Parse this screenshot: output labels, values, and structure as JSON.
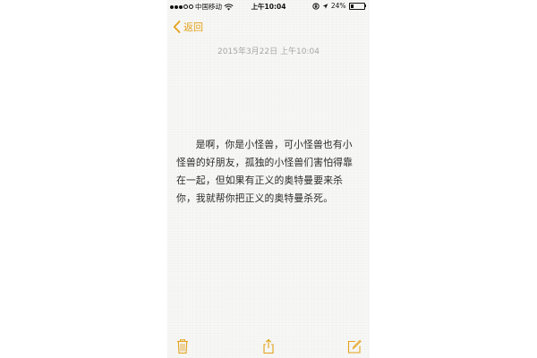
{
  "status_bar": {
    "carrier": "中国移动",
    "time": "上午10:04",
    "battery_percent_label": "24%",
    "battery_level": 0.24,
    "signal_bars_filled": 3,
    "signal_bars_total": 5
  },
  "nav": {
    "back_label": "返回"
  },
  "note": {
    "date": "2015年3月22日 上午10:04",
    "text": "是啊，你是小怪兽，可小怪兽也有小怪兽的好朋友，孤独的小怪兽们害怕得靠在一起，但如果有正义的奥特曼要来杀你，我就帮你把正义的奥特曼杀死。"
  },
  "toolbar": {
    "icons": [
      "trash-icon",
      "share-icon",
      "compose-icon"
    ]
  },
  "colors": {
    "accent": "#e3a21a",
    "background": "#f7f7f5",
    "date_text": "#a6a6a6",
    "body_text": "#2b2b2b"
  }
}
